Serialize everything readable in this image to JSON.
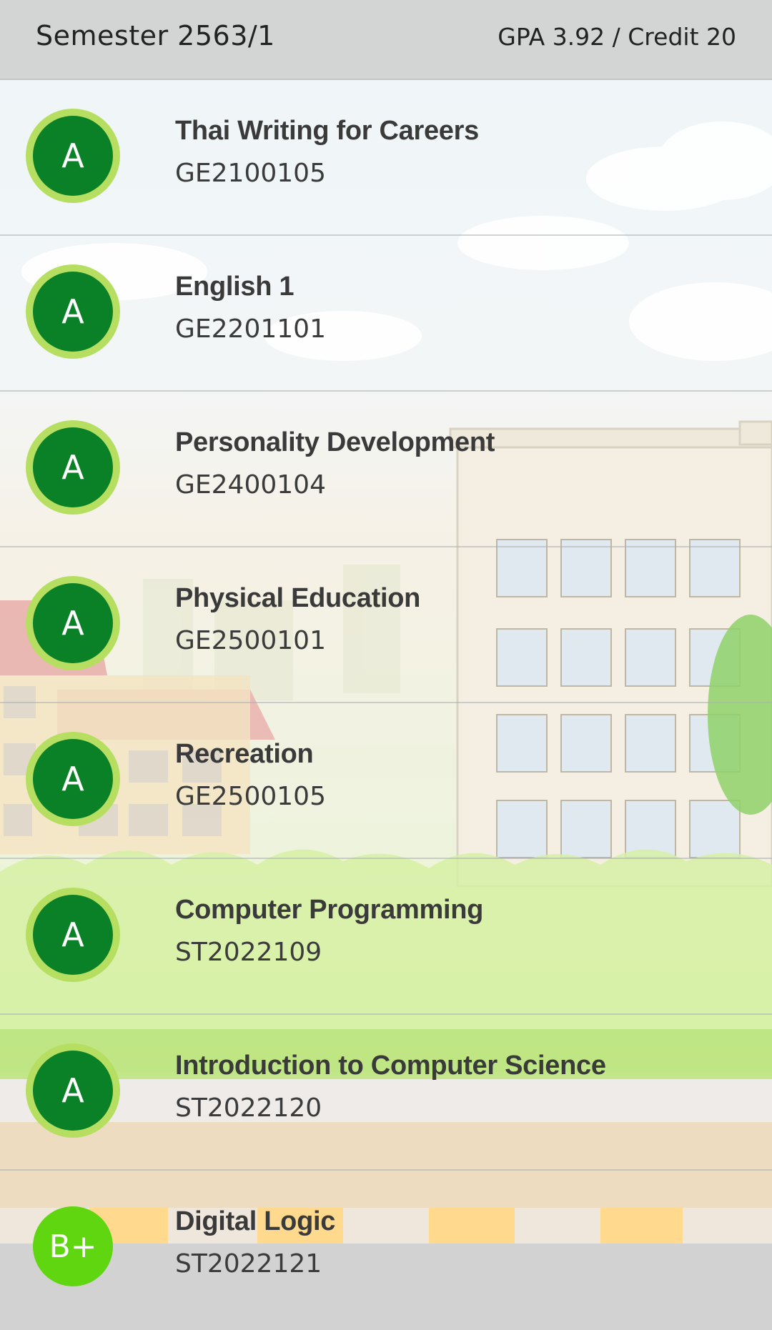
{
  "header": {
    "semester": "Semester 2563/1",
    "summary": "GPA 3.92 / Credit 20"
  },
  "courses": [
    {
      "grade": "A",
      "name": "Thai Writing for Careers",
      "code": "GE2100105"
    },
    {
      "grade": "A",
      "name": "English 1",
      "code": "GE2201101"
    },
    {
      "grade": "A",
      "name": "Personality Development",
      "code": "GE2400104"
    },
    {
      "grade": "A",
      "name": "Physical Education",
      "code": "GE2500101"
    },
    {
      "grade": "A",
      "name": "Recreation",
      "code": "GE2500105"
    },
    {
      "grade": "A",
      "name": "Computer Programming",
      "code": "ST2022109"
    },
    {
      "grade": "A",
      "name": "Introduction to Computer Science",
      "code": "ST2022120"
    },
    {
      "grade": "B+",
      "name": "Digital Logic",
      "code": "ST2022121"
    }
  ],
  "colors": {
    "grade_a_fill": "#0a8127",
    "grade_a_ring": "#b6df62",
    "grade_bplus_fill": "#5fd60f",
    "header_bg": "#d3d4d4"
  }
}
